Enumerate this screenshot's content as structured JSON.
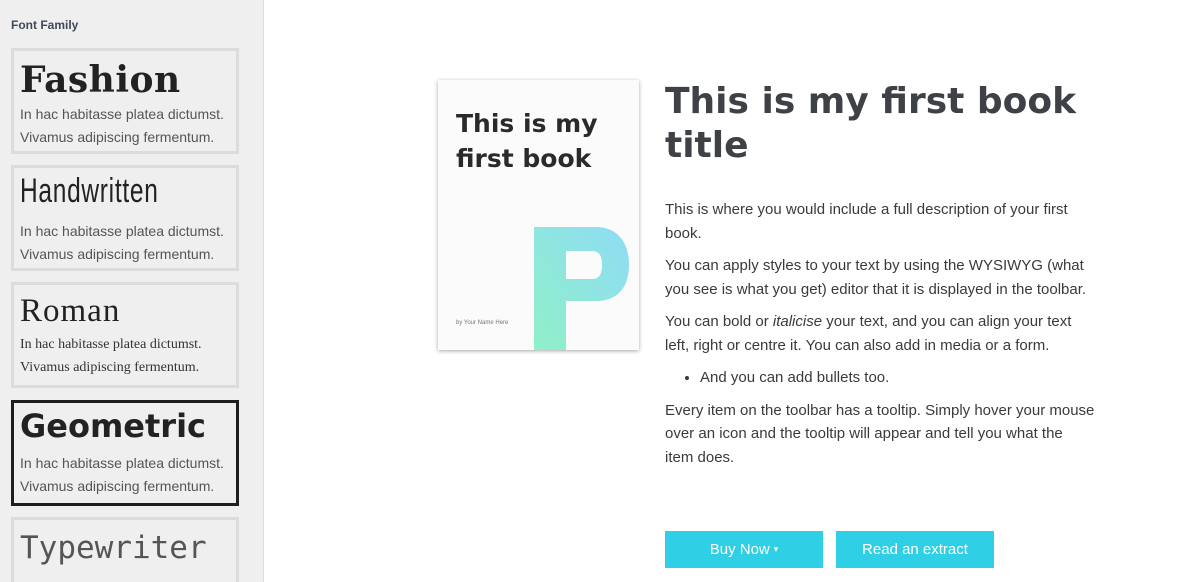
{
  "sidebar": {
    "title": "Font Family",
    "cards": [
      {
        "name": "Fashion",
        "sample_line1": "In hac habitasse platea dictumst.",
        "sample_line2": "Vivamus adipiscing fermentum."
      },
      {
        "name": "Handwritten",
        "sample_line1": "In hac habitasse platea dictumst.",
        "sample_line2": "Vivamus adipiscing fermentum."
      },
      {
        "name": "Roman",
        "sample_line1": "In hac habitasse platea dictumst.",
        "sample_line2": "Vivamus adipiscing fermentum."
      },
      {
        "name": "Geometric",
        "sample_line1": "In hac habitasse platea dictumst.",
        "sample_line2": "Vivamus adipiscing fermentum."
      },
      {
        "name": "Typewriter"
      }
    ],
    "selected": "Geometric"
  },
  "cover": {
    "title": "This is my first book",
    "author": "by Your Name Here",
    "logo_icon": "f-logo-icon",
    "logo_gradient": [
      "#8ff0c8",
      "#8fdcf5"
    ]
  },
  "book": {
    "title": "This is my first book title",
    "para1": "This is where you would include a full description of your first book.",
    "para2": "You can apply styles to your text by using the WYSIWYG (what you see is what you get) editor that it is displayed in the toolbar.",
    "para3_a": "You can bold or ",
    "para3_italic": "italicise",
    "para3_b": " your text, and you can align your text left, right or centre it. You can also add in media or a form.",
    "bullet1": "And you can add bullets too.",
    "para4": "Every item on the toolbar has a tooltip. Simply hover your mouse over an icon and the tooltip will appear and tell you what the item does."
  },
  "buttons": {
    "buy_label": "Buy Now",
    "buy_caret": "▾",
    "read_label": "Read an extract"
  },
  "colors": {
    "accent": "#2fd0e6",
    "sidebar_bg": "#efefef",
    "selected_border": "#1e1e1e"
  }
}
